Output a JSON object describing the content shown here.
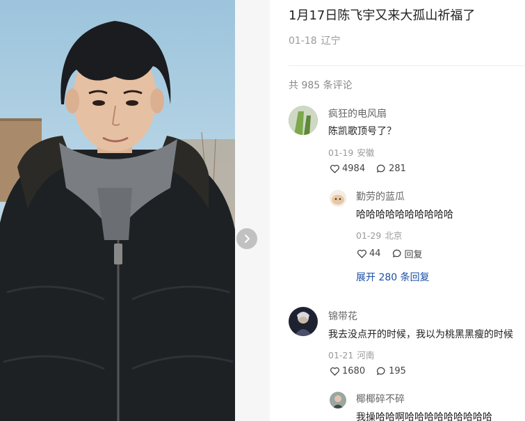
{
  "post": {
    "title": "1月17日陈飞宇又来大孤山祈福了",
    "date": "01-18",
    "location": "辽宁",
    "comment_count_label": "共 985 条评论"
  },
  "comments": [
    {
      "user": "疯狂的电风扇",
      "text": "陈凯歌顶号了？",
      "date": "01-19",
      "location": "安徽",
      "likes": "4984",
      "replies": "281",
      "reply": {
        "user": "勤劳的蓝瓜",
        "text": "哈哈哈哈哈哈哈哈哈哈",
        "date": "01-29",
        "location": "北京",
        "likes": "44",
        "reply_label": "回复"
      },
      "expand_label": "展开 280 条回复"
    },
    {
      "user": "锦带花",
      "text": "我去没点开的时候，我以为桃黑黑瘦的时候",
      "date": "01-21",
      "location": "河南",
      "likes": "1680",
      "replies": "195",
      "reply": {
        "user": "椰椰碎不碎",
        "text": "我操哈哈啊哈哈哈哈哈哈哈哈哈"
      }
    }
  ],
  "colors": {
    "link": "#1a4ea5",
    "muted": "#999999",
    "text": "#222222"
  },
  "icons": {
    "like": "heart-outline-icon",
    "comment": "speech-bubble-icon",
    "next": "chevron-right-icon"
  }
}
